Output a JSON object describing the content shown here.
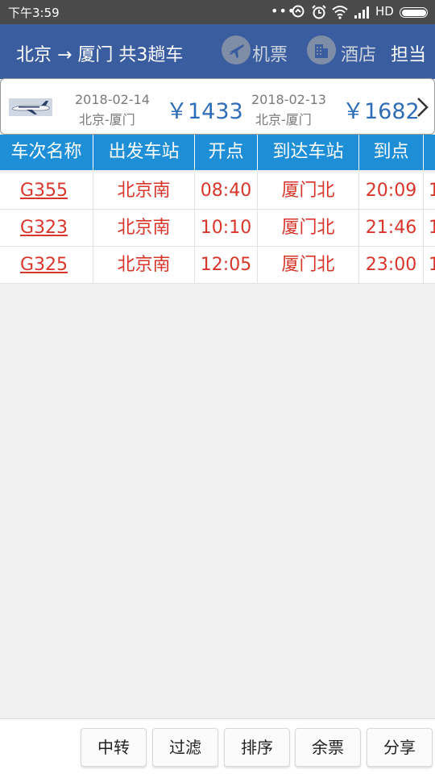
{
  "statusbar": {
    "time": "下午3:59",
    "dots": "•••",
    "network": "HD",
    "icons": [
      "messenger-icon",
      "alarm-icon",
      "wifi-icon",
      "signal-icon",
      "battery-icon"
    ]
  },
  "header": {
    "title": "北京 → 厦门 共3趟车",
    "flight_label": "机票",
    "flight_icon": "plane-icon",
    "hotel_label": "酒店",
    "hotel_icon": "building-icon",
    "more_label": "担当"
  },
  "flights": [
    {
      "date": "2018-02-14",
      "route": "北京-厦门",
      "price": "￥1433"
    },
    {
      "date": "2018-02-13",
      "route": "北京-厦门",
      "price": "￥1682"
    }
  ],
  "table": {
    "headers": [
      "车次名称",
      "出发车站",
      "开点",
      "到达车站",
      "到点",
      ""
    ],
    "rows": [
      [
        "G355",
        "北京南",
        "08:40",
        "厦门北",
        "20:09",
        "1"
      ],
      [
        "G323",
        "北京南",
        "10:10",
        "厦门北",
        "21:46",
        "1"
      ],
      [
        "G325",
        "北京南",
        "12:05",
        "厦门北",
        "23:00",
        "1"
      ]
    ]
  },
  "toolbar": {
    "buttons": [
      "中转",
      "过滤",
      "排序",
      "余票",
      "分享"
    ]
  },
  "colors": {
    "header_bg": "#3a5da0",
    "table_header_bg": "#1e8ed7",
    "price": "#2f6db8",
    "row_text": "#d8362a"
  }
}
